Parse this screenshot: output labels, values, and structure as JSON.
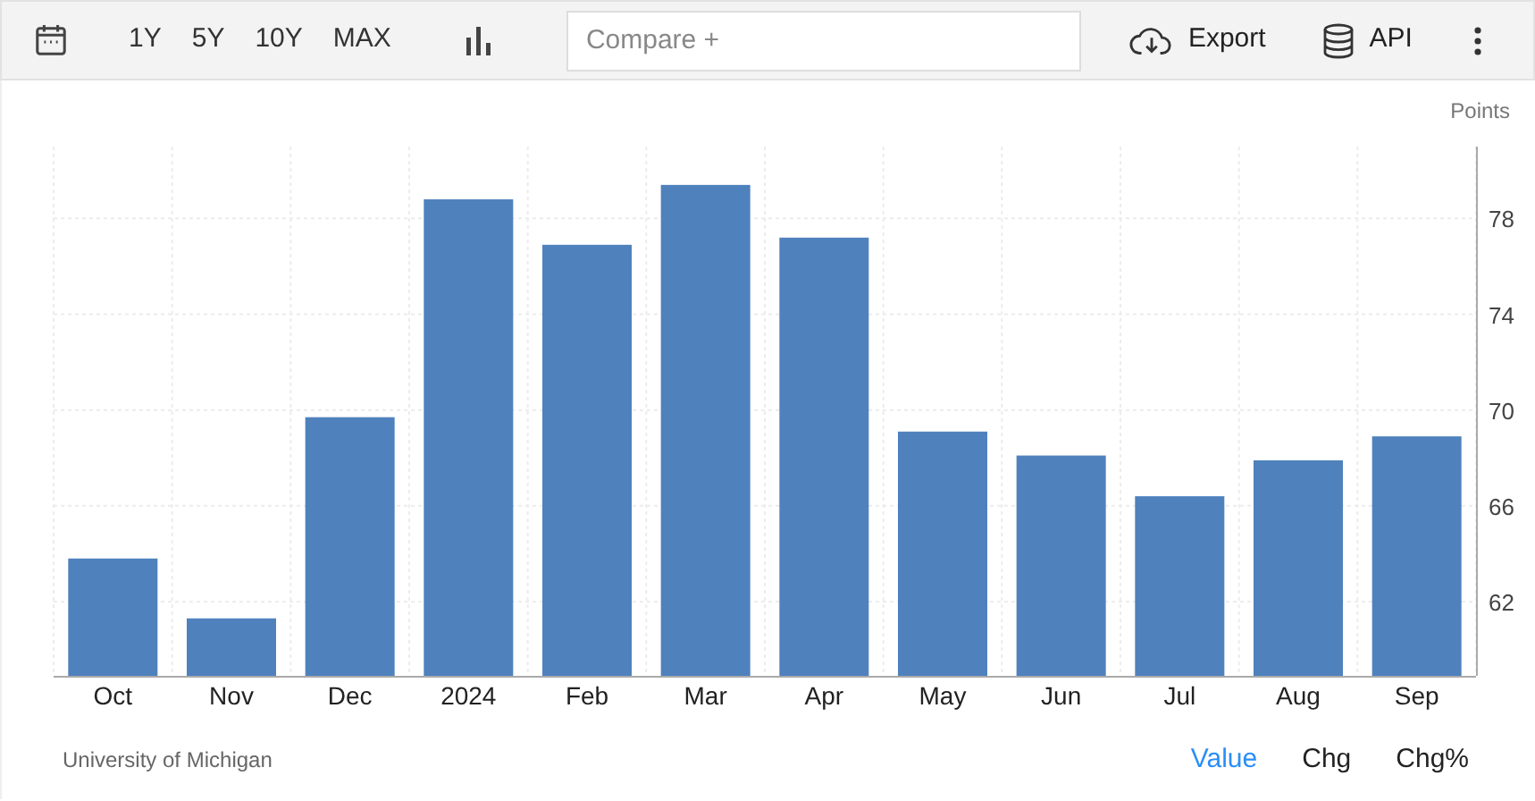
{
  "toolbar": {
    "ranges": [
      {
        "label": "1Y",
        "selected": false
      },
      {
        "label": "5Y",
        "selected": false
      },
      {
        "label": "10Y",
        "selected": false
      },
      {
        "label": "MAX",
        "selected": false
      }
    ],
    "compare": {
      "placeholder": "Compare +"
    },
    "export": "Export",
    "api": "API"
  },
  "chart": {
    "unit_label": "Points",
    "chart_data": {
      "type": "bar",
      "categories": [
        "Oct",
        "Nov",
        "Dec",
        "2024",
        "Feb",
        "Mar",
        "Apr",
        "May",
        "Jun",
        "Jul",
        "Aug",
        "Sep"
      ],
      "series": [
        {
          "color": "#4f81bd",
          "values": [
            63.8,
            61.3,
            69.7,
            78.8,
            76.9,
            79.4,
            77.2,
            69.1,
            68.1,
            66.4,
            67.9,
            68.9
          ]
        }
      ],
      "ylim": [
        58.9,
        81
      ],
      "yticks": [
        62,
        66,
        70,
        74,
        78
      ],
      "grid": true
    }
  },
  "footer": {
    "source": "University of Michigan",
    "tabs": [
      {
        "label": "Value",
        "selected": true
      },
      {
        "label": "Chg",
        "selected": false
      },
      {
        "label": "Chg%",
        "selected": false
      }
    ]
  }
}
